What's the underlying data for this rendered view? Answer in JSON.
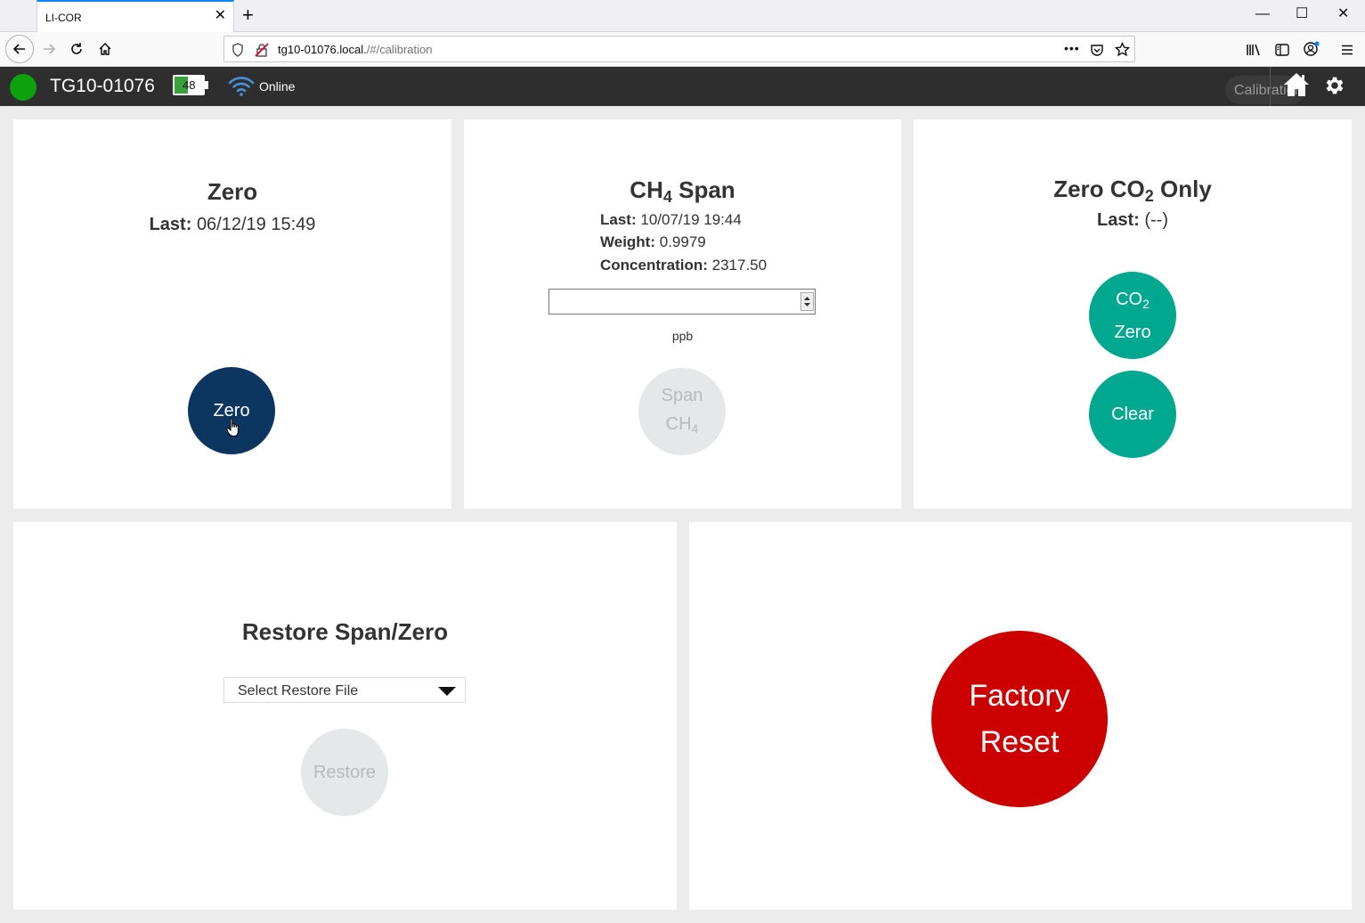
{
  "browser": {
    "tab_title": "LI-COR",
    "close_symbol": "✕",
    "new_tab_symbol": "+",
    "url_host": "tg10-01076.local.",
    "url_path": "/#/calibration",
    "minimize_symbol": "—",
    "maximize_symbol": "☐",
    "window_close_symbol": "✕",
    "page_actions_symbol": "•••"
  },
  "header": {
    "device_name": "TG10-01076",
    "battery_level": "48",
    "battery_fraction": 0.48,
    "network_status": "Online",
    "page_label": "Calibration",
    "status_color": "#0da10d"
  },
  "zero_card": {
    "title": "Zero",
    "last_label": "Last:",
    "last_value": "06/12/19 15:49",
    "button_label": "Zero",
    "button_color": "#0c3660"
  },
  "ch4_card": {
    "title_prefix": "CH",
    "title_sub": "4",
    "title_suffix": "Span",
    "last_label": "Last:",
    "last_value": "10/07/19 19:44",
    "weight_label": "Weight:",
    "weight_value": "0.9979",
    "conc_label": "Concentration:",
    "conc_value": "2317.50",
    "input_value": "",
    "unit": "ppb",
    "button_line1": "Span",
    "button_line2_prefix": "CH",
    "button_line2_sub": "4",
    "button_color": "#e6e7e8"
  },
  "co2_card": {
    "title_prefix": "Zero CO",
    "title_sub": "2",
    "title_suffix": "Only",
    "last_label": "Last:",
    "last_value": "(--)",
    "zero_button_prefix": "CO",
    "zero_button_sub": "2",
    "zero_button_line2": "Zero",
    "clear_button": "Clear",
    "button_color": "#00a890"
  },
  "restore_card": {
    "title": "Restore Span/Zero",
    "select_placeholder": "Select Restore File",
    "button_label": "Restore"
  },
  "factory_card": {
    "button_line1": "Factory",
    "button_line2": "Reset",
    "button_color": "#cc0000"
  }
}
